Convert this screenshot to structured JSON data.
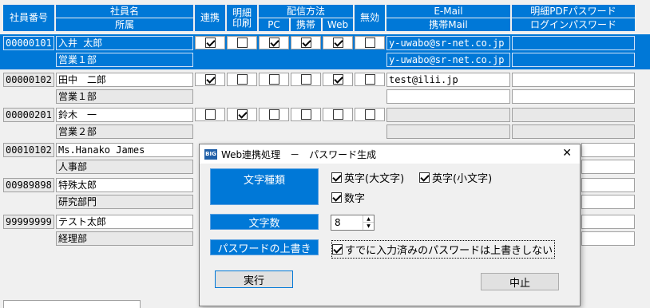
{
  "header": {
    "emp_no": "社員番号",
    "emp_name": "社員名",
    "dept": "所属",
    "renkei": "連携",
    "meisai_1": "明細",
    "meisai_2": "印刷",
    "delivery": "配信方法",
    "pc": "PC",
    "mobile": "携帯",
    "web": "Web",
    "disabled": "無効",
    "email": "E-Mail",
    "mobile_mail": "携帯Mail",
    "pdf_password": "明細PDFパスワード",
    "login_password": "ログインパスワード"
  },
  "rows": [
    {
      "emp_no": "00000101",
      "name": "入井 太郎",
      "dept": "営業１部",
      "checks": [
        true,
        false,
        true,
        true,
        true,
        false
      ],
      "email": "y-uwabo@sr-net.co.jp",
      "mobile_mail": "y-uwabo@sr-net.co.jp",
      "selected": true
    },
    {
      "emp_no": "00000102",
      "name": "田中　二郎",
      "dept": "営業１部",
      "checks": [
        true,
        false,
        false,
        false,
        true,
        false
      ],
      "email": "test@ilii.jp",
      "mobile_mail": "",
      "selected": false
    },
    {
      "emp_no": "00000201",
      "name": "鈴木　一",
      "dept": "営業２部",
      "checks": [
        false,
        true,
        false,
        false,
        false,
        false
      ],
      "email": "",
      "mobile_mail": "",
      "selected": false
    },
    {
      "emp_no": "00010102",
      "name": "Ms.Hanako James",
      "dept": "人事部"
    },
    {
      "emp_no": "00989898",
      "name": "特殊太郎",
      "dept": "研究部門"
    },
    {
      "emp_no": "99999999",
      "name": "テスト太郎",
      "dept": "経理部"
    }
  ],
  "dialog": {
    "icon_text": "BIG",
    "title": "Web連携処理　－　パスワード生成",
    "close": "✕",
    "char_types_label": "文字種類",
    "opt_upper": "英字(大文字)",
    "opt_lower": "英字(小文字)",
    "opt_digit": "数字",
    "opt_upper_checked": true,
    "opt_lower_checked": true,
    "opt_digit_checked": true,
    "length_label": "文字数",
    "length_value": "8",
    "overwrite_label": "パスワードの上書き",
    "overwrite_option": "すでに入力済みのパスワードは上書きしない",
    "overwrite_checked": true,
    "run_button": "実行",
    "cancel_button": "中止"
  }
}
